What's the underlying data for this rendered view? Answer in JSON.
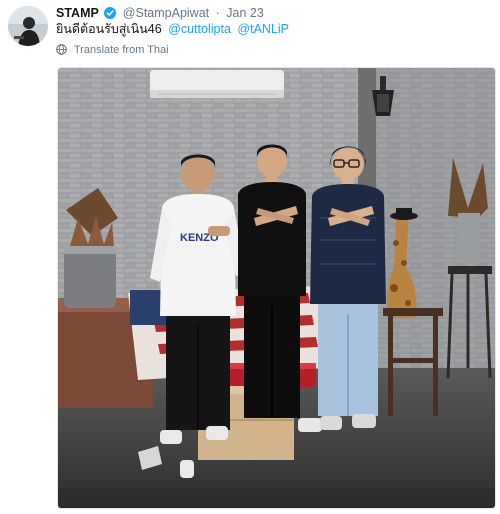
{
  "tweet": {
    "display_name": "STAMP",
    "handle": "@StampApiwat",
    "separator": "·",
    "date": "Jan 23",
    "text": "ยินดีต้อนรับสู่เนิน46",
    "mentions": [
      "@cuttolipta",
      "@tANLiP"
    ],
    "translate_label": "Translate from Thai",
    "shirt_text": "KENZO"
  },
  "icons": {
    "verified": "verified-badge-icon",
    "translate": "globe-icon"
  },
  "colors": {
    "link": "#1da1f2",
    "secondary_text": "#657786",
    "verified": "#1da1f2"
  }
}
